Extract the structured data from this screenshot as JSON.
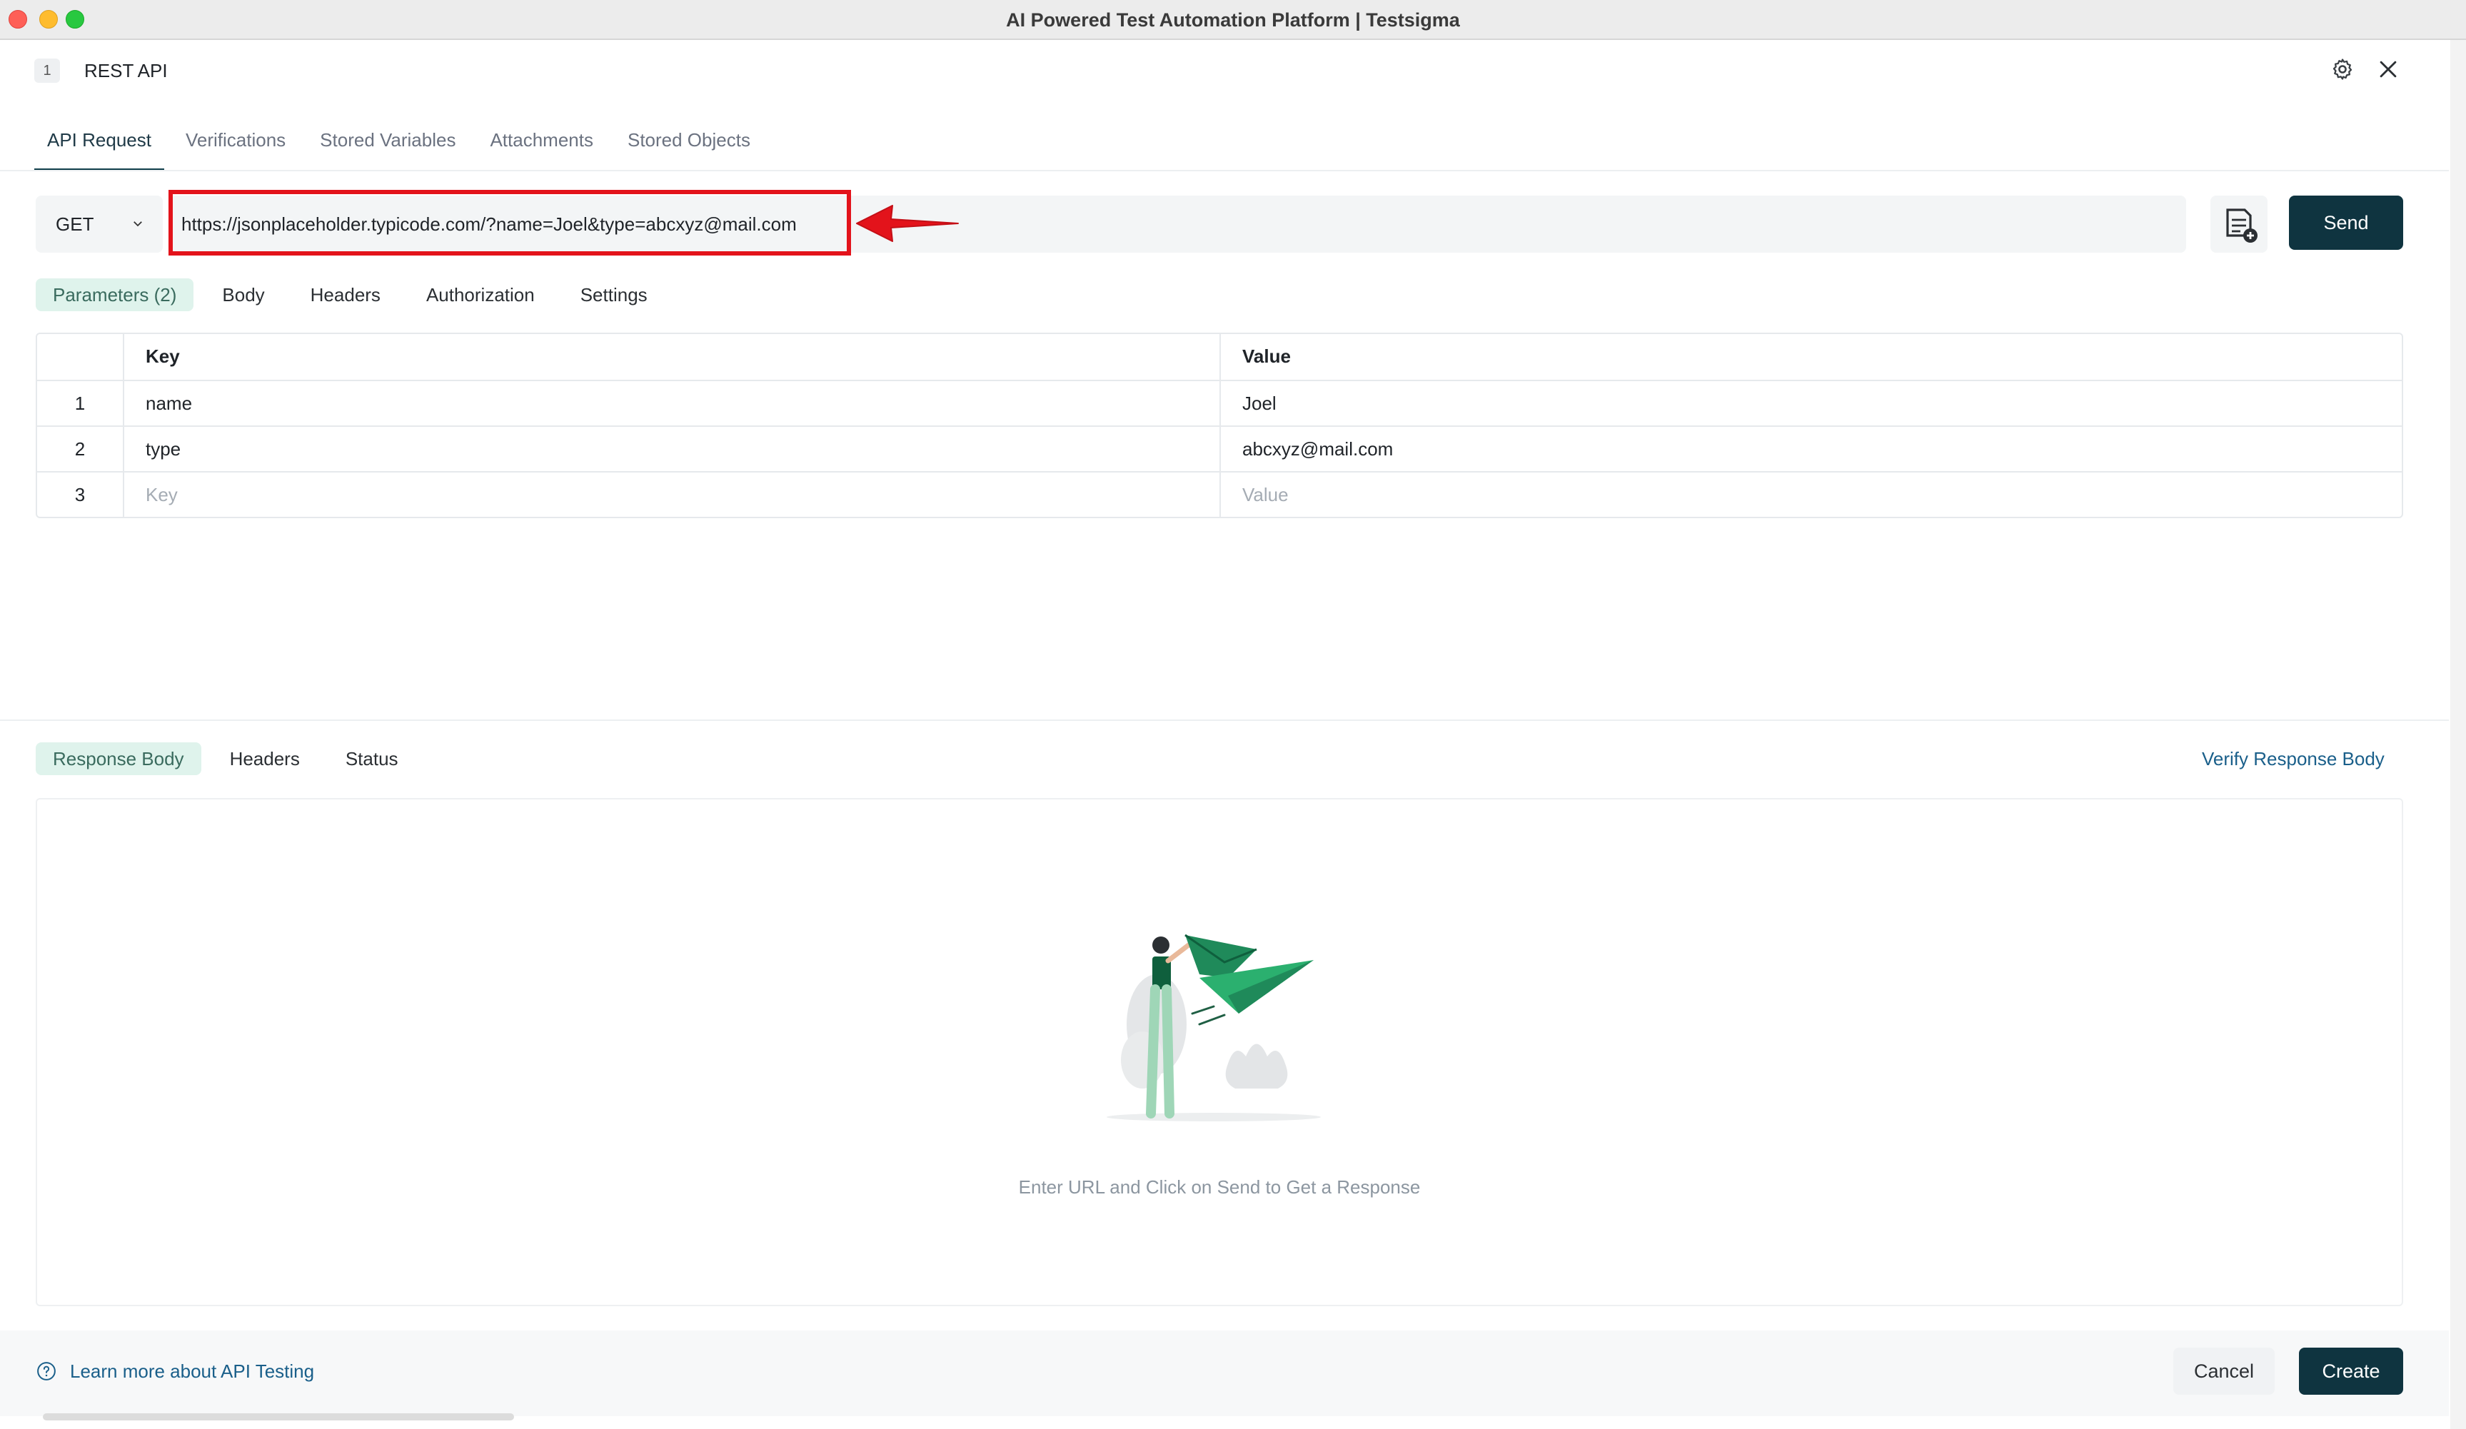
{
  "window": {
    "title": "AI Powered Test Automation Platform | Testsigma"
  },
  "header": {
    "step_number": "1",
    "title": "REST API"
  },
  "main_tabs": [
    {
      "label": "API Request",
      "active": true
    },
    {
      "label": "Verifications"
    },
    {
      "label": "Stored Variables"
    },
    {
      "label": "Attachments"
    },
    {
      "label": "Stored Objects"
    }
  ],
  "request": {
    "method": "GET",
    "url": "https://jsonplaceholder.typicode.com/?name=Joel&type=abcxyz@mail.com",
    "send_label": "Send"
  },
  "request_tabs": [
    {
      "label": "Parameters (2)",
      "active": true
    },
    {
      "label": "Body"
    },
    {
      "label": "Headers"
    },
    {
      "label": "Authorization"
    },
    {
      "label": "Settings"
    }
  ],
  "params_table": {
    "headers": {
      "key": "Key",
      "value": "Value"
    },
    "rows": [
      {
        "index": "1",
        "key": "name",
        "value": "Joel"
      },
      {
        "index": "2",
        "key": "type",
        "value": "abcxyz@mail.com"
      }
    ],
    "empty_row": {
      "index": "3",
      "key_placeholder": "Key",
      "value_placeholder": "Value"
    }
  },
  "response_tabs": [
    {
      "label": "Response Body",
      "active": true
    },
    {
      "label": "Headers"
    },
    {
      "label": "Status"
    }
  ],
  "response": {
    "verify_link": "Verify Response Body",
    "empty_message": "Enter URL and Click on Send to Get a Response"
  },
  "footer": {
    "learn_link": "Learn more about API Testing",
    "cancel_label": "Cancel",
    "create_label": "Create"
  },
  "colors": {
    "primary": "#0f3440",
    "highlight": "#e3131b",
    "active_tab_bg": "#dff3ec",
    "link": "#1a5f8a"
  }
}
